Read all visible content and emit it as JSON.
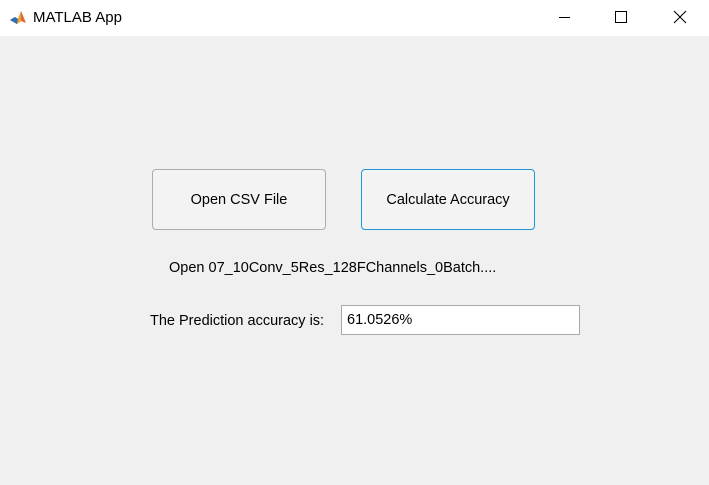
{
  "window": {
    "title": "MATLAB App",
    "icon": "matlab-membrane-icon",
    "controls": {
      "minimize_icon": "minimize-icon",
      "maximize_icon": "maximize-icon",
      "close_icon": "close-icon"
    }
  },
  "main": {
    "open_button_label": "Open CSV File",
    "calculate_button_label": "Calculate Accuracy",
    "file_label": "Open 07_10Conv_5Res_128FChannels_0Batch....",
    "accuracy_label": "The Prediction accuracy is:",
    "accuracy_value": "61.0526%"
  },
  "colors": {
    "background": "#f0f0f0",
    "titlebar": "#ffffff",
    "focus_border": "#2196d4"
  }
}
